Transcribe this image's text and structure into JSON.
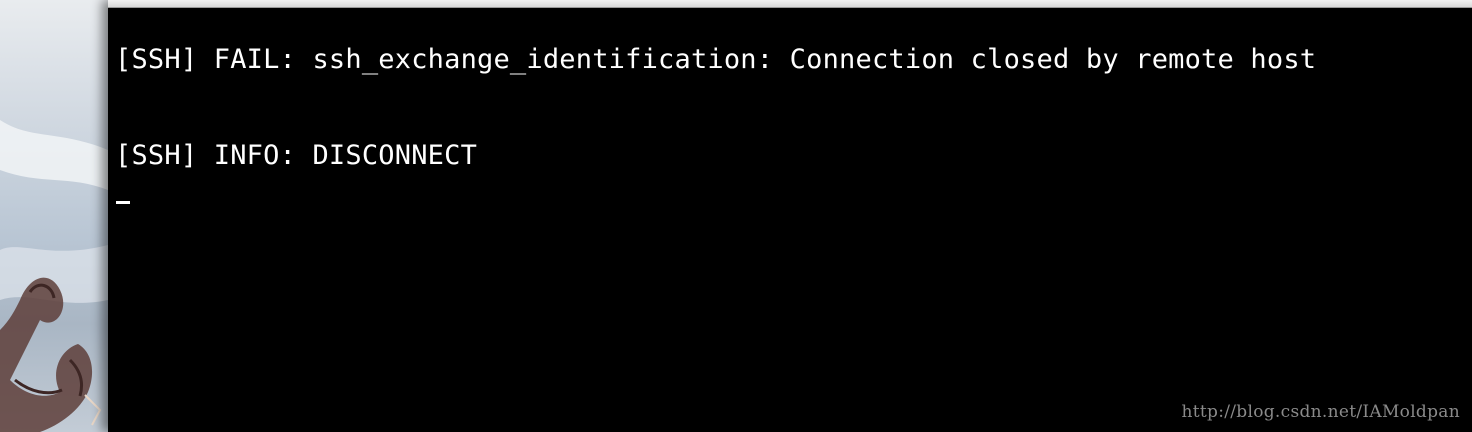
{
  "terminal": {
    "lines": [
      "[SSH] FAIL: ssh_exchange_identification: Connection closed by remote host",
      "[SSH] INFO: DISCONNECT"
    ],
    "background_color": "#000000",
    "text_color": "#ffffff"
  },
  "watermark": {
    "text": "http://blog.csdn.net/IAMoldpan"
  }
}
